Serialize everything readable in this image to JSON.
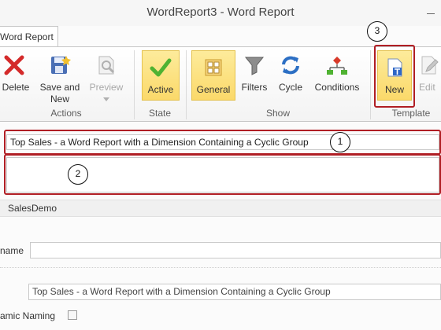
{
  "window": {
    "title": "WordReport3 - Word Report"
  },
  "tab": {
    "label": "Word Report"
  },
  "ribbon": {
    "groups": {
      "actions": "Actions",
      "state": "State",
      "show": "Show",
      "template": "Template"
    },
    "buttons": {
      "delete": "Delete",
      "save_line1": "Save and",
      "save_line2": "New",
      "preview": "Preview",
      "active": "Active",
      "general": "General",
      "filters": "Filters",
      "cycle": "Cycle",
      "conditions": "Conditions",
      "new": "New",
      "edit": "Edit"
    }
  },
  "callouts": {
    "one": "1",
    "two": "2",
    "three": "3"
  },
  "form": {
    "title_value": "Top Sales - a Word Report with a Dimension Containing a Cyclic Group",
    "description_value": "",
    "app_name": "SalesDemo",
    "name_label": "name",
    "name_value": "",
    "preview_name": "Top Sales - a Word Report with a Dimension Containing a Cyclic Group",
    "dynamic_label": "amic Naming",
    "dynamic_checked": false
  },
  "colors": {
    "accent_red": "#b01e24",
    "selected_yellow": "#fbd96a"
  }
}
